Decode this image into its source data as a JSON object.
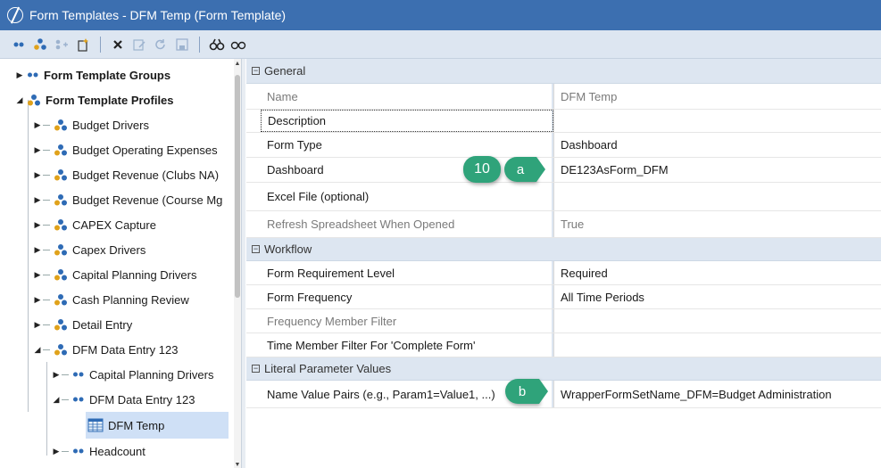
{
  "window": {
    "title": "Form Templates - DFM Temp (Form Template)"
  },
  "toolbar": {
    "buttons": [
      "expand-all",
      "collapse-tree",
      "add-group",
      "create-new",
      "delete",
      "rename",
      "refresh",
      "save",
      "search",
      "binoculars"
    ]
  },
  "tree": {
    "items": [
      {
        "label": "Form Template Groups",
        "bold": true
      },
      {
        "label": "Form Template Profiles",
        "bold": true
      },
      {
        "label": "Budget Drivers"
      },
      {
        "label": "Budget Operating Expenses"
      },
      {
        "label": "Budget Revenue (Clubs NA)"
      },
      {
        "label": "Budget Revenue (Course Mg"
      },
      {
        "label": "CAPEX Capture"
      },
      {
        "label": "Capex Drivers"
      },
      {
        "label": "Capital Planning Drivers"
      },
      {
        "label": "Cash Planning Review"
      },
      {
        "label": "Detail Entry"
      },
      {
        "label": "DFM Data Entry 123"
      },
      {
        "label": "Capital Planning Drivers"
      },
      {
        "label": "DFM Data Entry 123"
      },
      {
        "label": "DFM Temp"
      },
      {
        "label": "Headcount"
      }
    ]
  },
  "properties": {
    "general": {
      "header": "General",
      "rows": [
        {
          "name": "Name",
          "value": "DFM Temp"
        },
        {
          "name": "Description",
          "value": ""
        },
        {
          "name": "Form Type",
          "value": "Dashboard"
        },
        {
          "name": "Dashboard",
          "value": "DE123AsForm_DFM"
        },
        {
          "name": "Excel File (optional)",
          "value": ""
        },
        {
          "name": "Refresh Spreadsheet When Opened",
          "value": "True"
        }
      ]
    },
    "workflow": {
      "header": "Workflow",
      "rows": [
        {
          "name": "Form Requirement Level",
          "value": "Required"
        },
        {
          "name": "Form Frequency",
          "value": "All Time Periods"
        },
        {
          "name": "Frequency Member Filter",
          "value": ""
        },
        {
          "name": "Time Member Filter For 'Complete Form'",
          "value": ""
        }
      ]
    },
    "literal": {
      "header": "Literal Parameter Values",
      "rows": [
        {
          "name": "Name Value Pairs (e.g., Param1=Value1, ...)",
          "value": "WrapperFormSetName_DFM=Budget Administration"
        }
      ]
    }
  },
  "callouts": {
    "step": "10",
    "a": "a",
    "b": "b"
  },
  "colors": {
    "titlebar": "#3c6fb0",
    "callout": "#2fa37a",
    "selection": "#cfe0f6"
  }
}
